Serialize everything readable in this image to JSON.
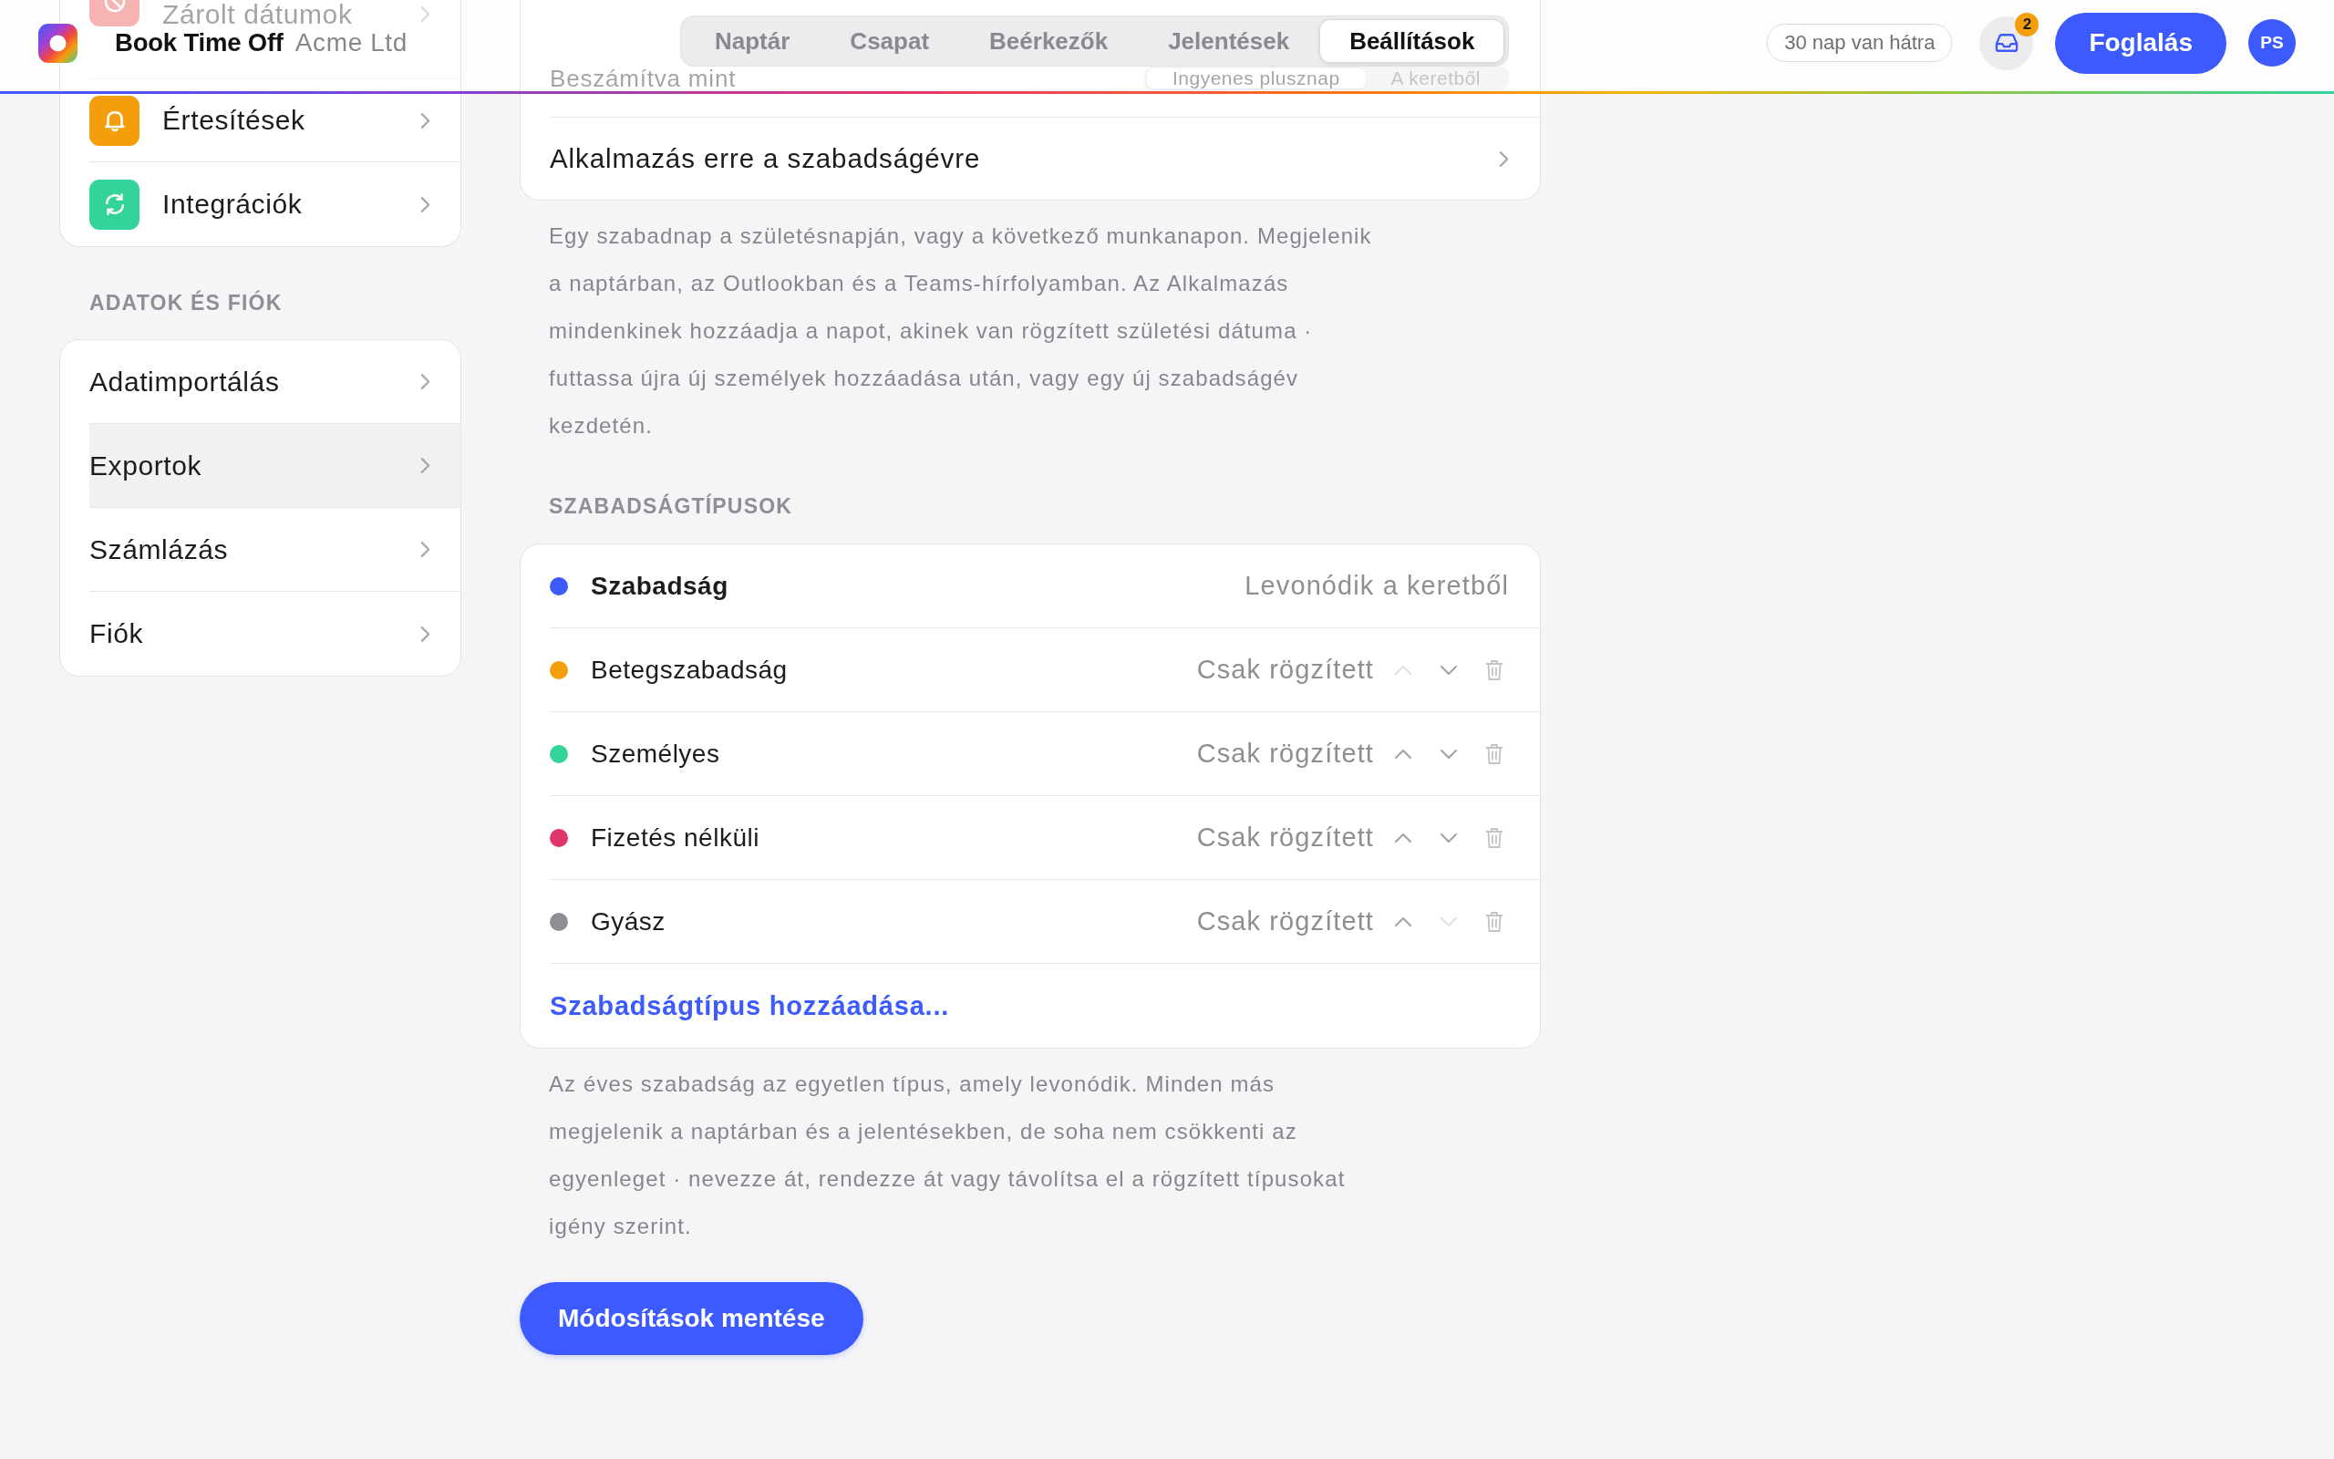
{
  "header": {
    "app_name": "Book Time Off",
    "organization": "Acme Ltd",
    "tabs": [
      {
        "label": "Naptár",
        "selected": false
      },
      {
        "label": "Csapat",
        "selected": false
      },
      {
        "label": "Beérkezők",
        "selected": false
      },
      {
        "label": "Jelentések",
        "selected": false
      },
      {
        "label": "Beállítások",
        "selected": true
      }
    ],
    "days_left": "30 nap van hátra",
    "inbox_count": "2",
    "book_button": "Foglalás",
    "avatar_initials": "PS"
  },
  "sidebar": {
    "groups": [
      {
        "items": [
          {
            "label": "Zárolt dátumok"
          },
          {
            "label": "Értesítések",
            "selected": false
          },
          {
            "label": "Integrációk",
            "selected": false
          }
        ]
      },
      {
        "heading": "ADATOK ÉS FIÓK",
        "items": [
          {
            "label": "Adatimportálás",
            "selected": false
          },
          {
            "label": "Exportok",
            "selected": true
          },
          {
            "label": "Számlázás",
            "selected": false
          },
          {
            "label": "Fiók",
            "selected": false
          }
        ]
      }
    ]
  },
  "main": {
    "settings_rows": [
      {
        "kind": "segmented",
        "label": "Beszámítva mint",
        "options": [
          {
            "label": "Ingyenes plusznap",
            "selected": true
          },
          {
            "label": "A keretből",
            "selected": false
          }
        ]
      },
      {
        "kind": "link",
        "label": "Alkalmazás erre a szabadságévre"
      }
    ],
    "description": "Egy szabadnap a születésnapján, vagy a következő munkanapon. Megjelenik a naptárban, az Outlookban és a Teams-hírfolyamban. Az Alkalmazás mindenkinek hozzáadja a napot, akinek van rögzített születési dátuma · futtassa újra új személyek hozzáadása után, vagy egy új szabadságév kezdetén.",
    "leave_types_heading": "SZABADSÁGTÍPUSOK",
    "leave_types": [
      {
        "name": "Szabadság",
        "kind": "deducting",
        "status": "Levonódik a keretből",
        "color": "#3d5afe"
      },
      {
        "name": "Betegszabadság",
        "kind": "tracked",
        "status": "Csak rögzített",
        "color": "#f59e0b",
        "up_disabled": true,
        "down_disabled": false
      },
      {
        "name": "Személyes",
        "kind": "tracked",
        "status": "Csak rögzített",
        "color": "#34d399",
        "up_disabled": false,
        "down_disabled": false
      },
      {
        "name": "Fizetés nélküli",
        "kind": "tracked",
        "status": "Csak rögzített",
        "color": "#e0356b",
        "up_disabled": false,
        "down_disabled": false
      },
      {
        "name": "Gyász",
        "kind": "tracked",
        "status": "Csak rögzített",
        "color": "#8e8e93",
        "up_disabled": false,
        "down_disabled": true
      }
    ],
    "add_link": "Szabadságtípus hozzáadása...",
    "note": "Az éves szabadság az egyetlen típus, amely levonódik. Minden más megjelenik a naptárban és a jelentésekben, de soha nem csökkenti az egyenleget · nevezze át, rendezze át vagy távolítsa el a rögzített típusokat igény szerint.",
    "save_button": "Módosítások mentése"
  }
}
